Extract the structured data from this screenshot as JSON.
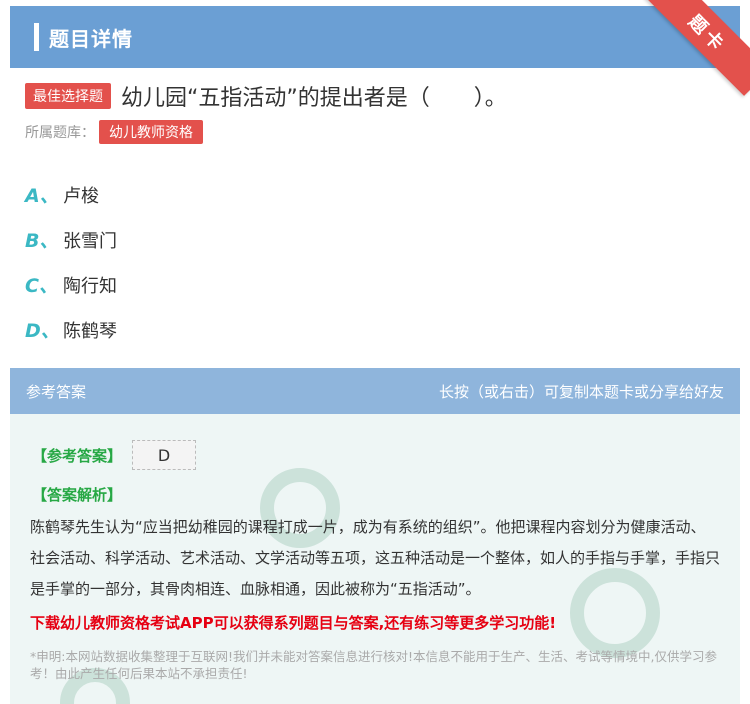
{
  "header": {
    "title": "题目详情"
  },
  "corner": {
    "label": "题卡"
  },
  "question": {
    "type_tag": "最佳选择题",
    "text": "幼儿园“五指活动”的提出者是（　　）。",
    "library_label": "所属题库：",
    "library_name": "幼儿教师资格"
  },
  "options": [
    {
      "letter": "A、",
      "text": "卢梭"
    },
    {
      "letter": "B、",
      "text": "张雪门"
    },
    {
      "letter": "C、",
      "text": "陶行知"
    },
    {
      "letter": "D、",
      "text": "陈鹤琴"
    }
  ],
  "answer": {
    "section_title": "参考答案",
    "share_hint": "长按（或右击）可复制本题卡或分享给好友",
    "ref_label": "【参考答案】",
    "ref_value": "D",
    "analysis_label": "【答案解析】",
    "analysis": "陈鹤琴先生认为“应当把幼稚园的课程打成一片，成为有系统的组织”。他把课程内容划分为健康活动、社会活动、科学活动、艺术活动、文学活动等五项，这五种活动是一个整体，如人的手指与手掌，手指只是手掌的一部分，其骨肉相连、血脉相通，因此被称为“五指活动”。",
    "promo": "下载幼儿教师资格考试APP可以获得系列题目与答案,还有练习等更多学习功能!",
    "disclaimer": "*申明:本网站数据收集整理于互联网!我们并未能对答案信息进行核对!本信息不能用于生产、生活、考试等情境中,仅供学习参考！由此产生任何后果本站不承担责任!"
  },
  "colors": {
    "header_bg": "#6b9fd4",
    "accent_red": "#e3514c",
    "option_letter": "#3bb8c4",
    "label_green": "#27a845",
    "promo_red": "#e60012"
  }
}
